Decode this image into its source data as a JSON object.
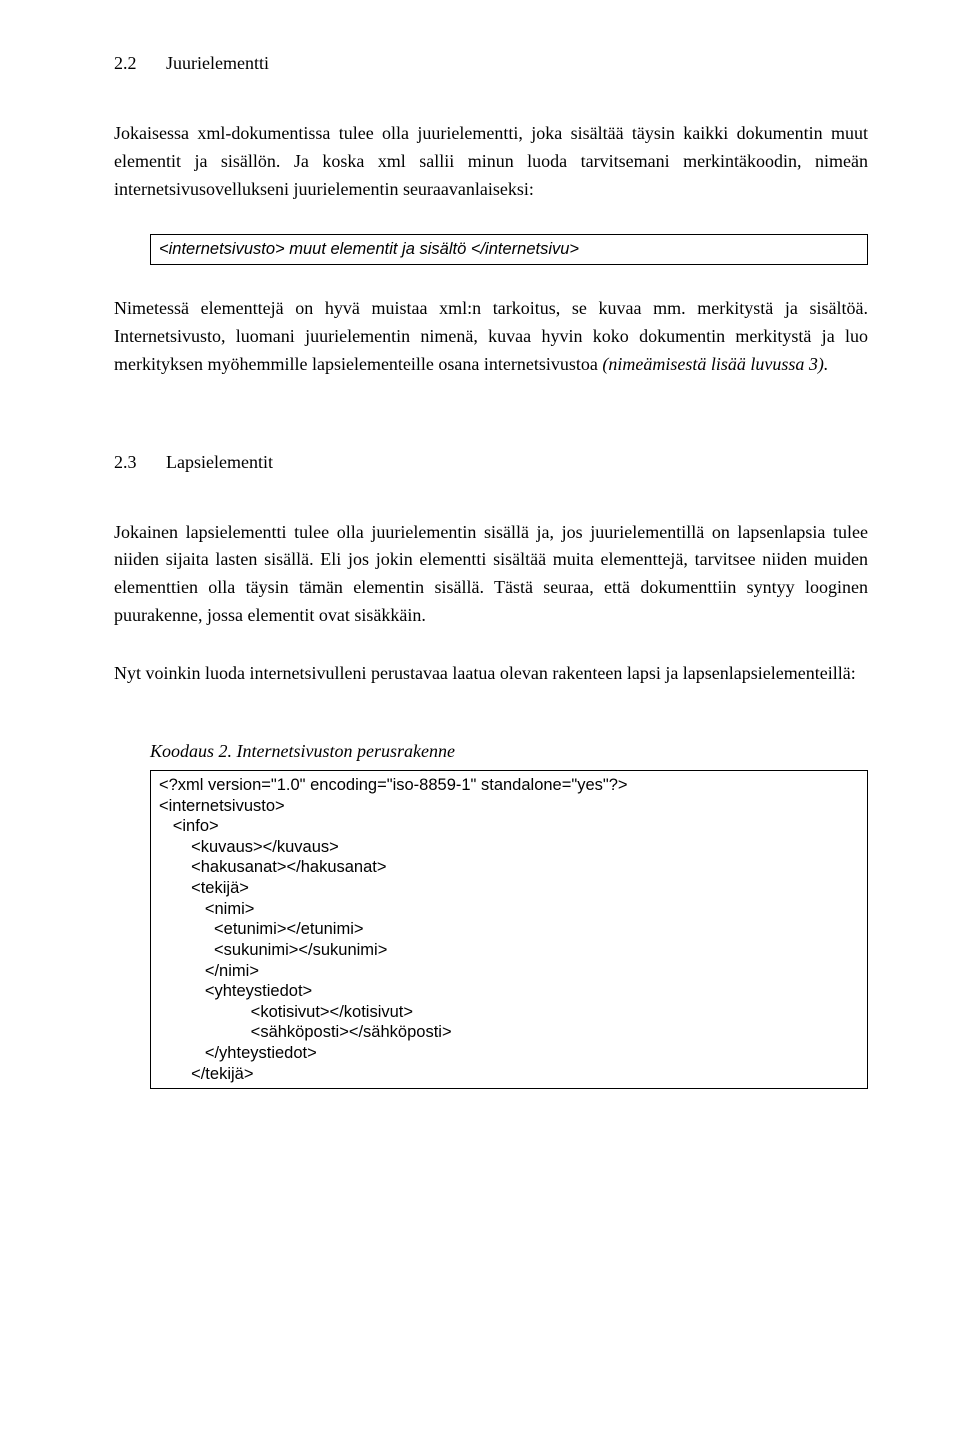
{
  "section1": {
    "num": "2.2",
    "title": "Juurielementti",
    "para1": "Jokaisessa xml-dokumentissa tulee olla juurielementti, joka sisältää täysin kaikki dokumentin muut elementit ja sisällön. Ja koska xml sallii minun luoda tarvitsemani merkintäkoodin, nimeän internetsivusovellukseni juurielementin seuraavanlaiseksi:",
    "codebox": "<internetsivusto> muut elementit ja sisältö </internetsivu>",
    "para2_a": "Nimetessä elementtejä on hyvä muistaa xml:n tarkoitus, se kuvaa mm. merkitystä ja sisältöä. Internetsivusto, luomani juurielementin nimenä, kuvaa hyvin koko dokumentin merkitystä ja luo merkityksen myöhemmille lapsielementeille osana internetsivustoa ",
    "para2_i": "(nimeämisestä lisää luvussa 3)."
  },
  "section2": {
    "num": "2.3",
    "title": "Lapsielementit",
    "para1": "Jokainen lapsielementti tulee olla juurielementin sisällä ja, jos juurielementillä on lapsenlapsia tulee niiden sijaita lasten sisällä. Eli jos jokin elementti sisältää muita elementtejä, tarvitsee niiden muiden elementtien olla täysin tämän elementin sisällä. Tästä seuraa, että dokumenttiin syntyy looginen puurakenne, jossa elementit ovat sisäkkäin.",
    "para2": "Nyt voinkin luoda internetsivulleni perustavaa laatua olevan rakenteen lapsi ja lapsenlapsielementeillä:",
    "code_caption": "Koodaus 2. Internetsivuston perusrakenne",
    "code_lines": [
      "<?xml version=\"1.0\" encoding=\"iso-8859-1\" standalone=\"yes\"?>",
      "<internetsivusto>",
      "   <info>",
      "       <kuvaus></kuvaus>",
      "       <hakusanat></hakusanat>",
      "       <tekijä>",
      "          <nimi>",
      "            <etunimi></etunimi>",
      "            <sukunimi></sukunimi>",
      "          </nimi>",
      "          <yhteystiedot>",
      "                    <kotisivut></kotisivut>",
      "                    <sähköposti></sähköposti>",
      "          </yhteystiedot>",
      "       </tekijä>"
    ]
  }
}
